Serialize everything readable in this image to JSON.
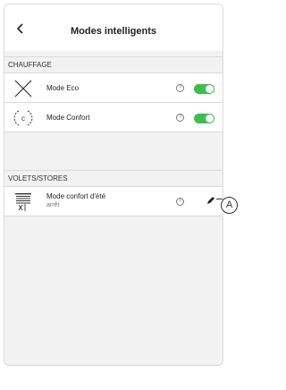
{
  "header": {
    "title": "Modes intelligents"
  },
  "sections": [
    {
      "title": "CHAUFFAGE",
      "items": [
        {
          "label": "Mode Eco",
          "icon": "eco-cross-icon",
          "help": "?",
          "toggle_on": true
        },
        {
          "label": "Mode Confort",
          "icon": "comfort-c-icon",
          "help": "?",
          "toggle_on": true
        }
      ]
    },
    {
      "title": "VOLETS/STORES",
      "items": [
        {
          "label": "Mode confort d'été",
          "subtitle": "arrêt",
          "icon": "shutter-icon",
          "help": "?",
          "edit_icon": "pencil-icon"
        }
      ]
    }
  ],
  "callout": {
    "label": "A"
  },
  "colors": {
    "toggle_on": "#3dbd4e",
    "background": "#f2f2f2",
    "divider": "#dadada"
  }
}
